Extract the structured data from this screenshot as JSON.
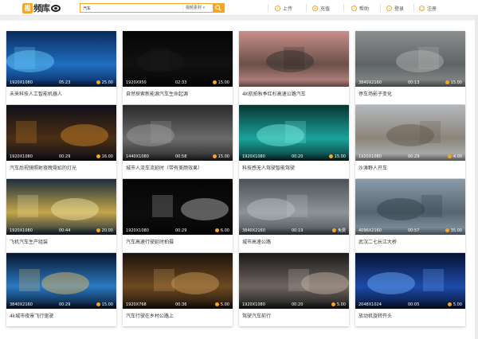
{
  "header": {
    "logo_mark": "视",
    "logo_text": "频库",
    "search_value": "汽车",
    "search_type": "视频素材",
    "search_icon": "search-icon",
    "nav": [
      {
        "label": "上传",
        "icon": "upload-icon"
      },
      {
        "label": "充值",
        "icon": "recharge-icon"
      },
      {
        "label": "帮助",
        "icon": "help-icon"
      },
      {
        "label": "登录",
        "icon": "login-icon"
      },
      {
        "label": "注册",
        "icon": "register-icon"
      }
    ]
  },
  "colors": {
    "accent": "#f5a623"
  },
  "videos": [
    {
      "res": "1920X1080",
      "dur": "05:23",
      "price": "25.00",
      "title": "未来科技人工智能机器人"
    },
    {
      "res": "1920X950",
      "dur": "02:33",
      "price": "15.00",
      "title": "自然探索新能源汽车生命起源"
    },
    {
      "res": "",
      "dur": "",
      "price": "",
      "title": "4K航拍秋季红杉高速公路汽车"
    },
    {
      "res": "3840X2160",
      "dur": "00:13",
      "price": "15.00",
      "title": "停车场影子变化"
    },
    {
      "res": "1920X1080",
      "dur": "00:29",
      "price": "16.00",
      "title": "汽车后视镜照射夜晚霓虹的灯光"
    },
    {
      "res": "1440X1080",
      "dur": "00:58",
      "price": "15.00",
      "title": "城市人流车流延时（带有美颜效果）"
    },
    {
      "res": "1920X1080",
      "dur": "00:20",
      "price": "15.00",
      "title": "科技感无人驾驶智能驾驶"
    },
    {
      "res": "1920X1080",
      "dur": "00:29",
      "price": "4.00",
      "title": "沙滩野人开车"
    },
    {
      "res": "1920X1080",
      "dur": "00:44",
      "price": "20.00",
      "title": "飞机汽车生产组装"
    },
    {
      "res": "1920X1080",
      "dur": "00:29",
      "price": "6.00",
      "title": "汽车高速行驶延时拍摄"
    },
    {
      "res": "3840X2160",
      "dur": "00:19",
      "price": "免费",
      "title": "城市高速公路"
    },
    {
      "res": "4096X2160",
      "dur": "00:57",
      "price": "35.00",
      "title": "武汉二七长江大桥"
    },
    {
      "res": "3840X2160",
      "dur": "00:29",
      "price": "15.00",
      "title": "4k城市夜景飞行驱驶"
    },
    {
      "res": "1920X768",
      "dur": "00:36",
      "price": "5.00",
      "title": "汽车行驶在乡村公路上"
    },
    {
      "res": "1920X1080",
      "dur": "00:20",
      "price": "5.00",
      "title": "驾驶汽车前行"
    },
    {
      "res": "2048X1024",
      "dur": "00:05",
      "price": "5.00",
      "title": "放动机旋转开头"
    }
  ]
}
